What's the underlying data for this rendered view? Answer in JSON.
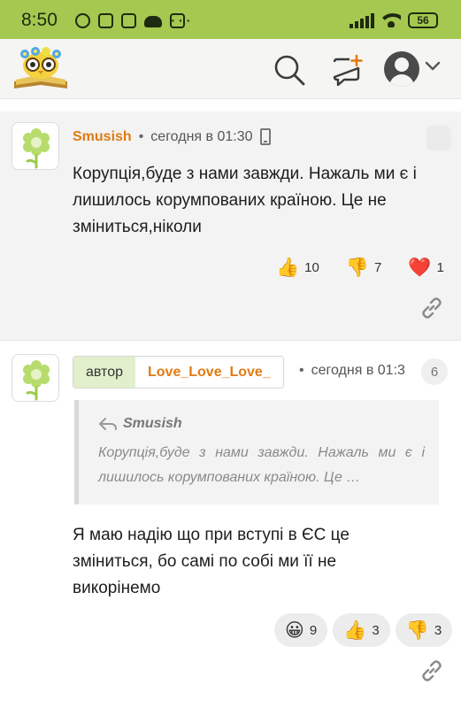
{
  "status_bar": {
    "time": "8:50",
    "battery": "56"
  },
  "header": {
    "logo_icon": "owl-book-logo-icon",
    "search_icon": "search-icon",
    "new_comment_icon": "new-comment-plus-icon",
    "profile_icon": "user-avatar-icon",
    "menu_icon": "chevron-down-icon"
  },
  "comments": [
    {
      "author": "Smusish",
      "time": "сегодня в 01:30",
      "device_icon": "mobile-phone-icon",
      "text": "Корупція,буде з нами завжди. Нажаль ми є і лишилось корумпованих країною. Це не зміниться,ніколи",
      "reactions": [
        {
          "emoji": "👍",
          "icon": "thumbs-up-icon",
          "count": "10"
        },
        {
          "emoji": "👎",
          "icon": "thumbs-down-icon",
          "count": "7"
        },
        {
          "emoji": "❤️",
          "icon": "heart-icon",
          "count": "1"
        }
      ]
    },
    {
      "role": "автор",
      "author": "Love_Love_Love_",
      "time": "сегодня в 01:3",
      "reply_number": "6",
      "quote": {
        "author": "Smusish",
        "text": "Корупція,буде з нами завжди. Нажаль ми є і лишилось корумпованих країною. Це …"
      },
      "text": "Я маю надію що при вступі в ЄС це зміниться, бо самі по собі ми її не викорінемо",
      "reactions": [
        {
          "emoji": "😀",
          "icon": "grinning-face-icon",
          "count": "9"
        },
        {
          "emoji": "👍",
          "icon": "thumbs-up-icon",
          "count": "3"
        },
        {
          "emoji": "👎",
          "icon": "thumbs-down-icon",
          "count": "3"
        }
      ]
    }
  ]
}
